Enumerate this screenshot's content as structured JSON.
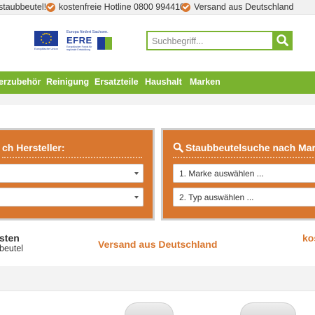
{
  "topbar": {
    "item1": "staubbeutel!",
    "item2": "kostenfreie Hotline 0800 9944100",
    "item3": "Versand aus Deutschland"
  },
  "header": {
    "eu_caption": "Europäische Union",
    "efre_top": "Europa fördert Sachsen.",
    "efre_word": "EFRE",
    "efre_sub": "Europäischer Fonds für regionale Entwicklung",
    "search_placeholder": "Suchbegriff..."
  },
  "nav": {
    "items": [
      "erzubehör",
      "Reinigung",
      "Ersatzteile",
      "Haushalt",
      "Marken"
    ]
  },
  "panels": {
    "left_title": "ch Hersteller:",
    "right_title": "Staubbeutelsuche nach Mar",
    "right_select1": "1. Marke auswählen ...",
    "right_select2": "2. Typ auswählen ..."
  },
  "info": {
    "left_strong": "sten",
    "left_sub": "beutel",
    "center": "Versand aus Deutschland",
    "right": "kos"
  },
  "colors": {
    "green": "#7ab32f",
    "orange": "#d9772f",
    "eu_blue": "#1f3d99"
  }
}
